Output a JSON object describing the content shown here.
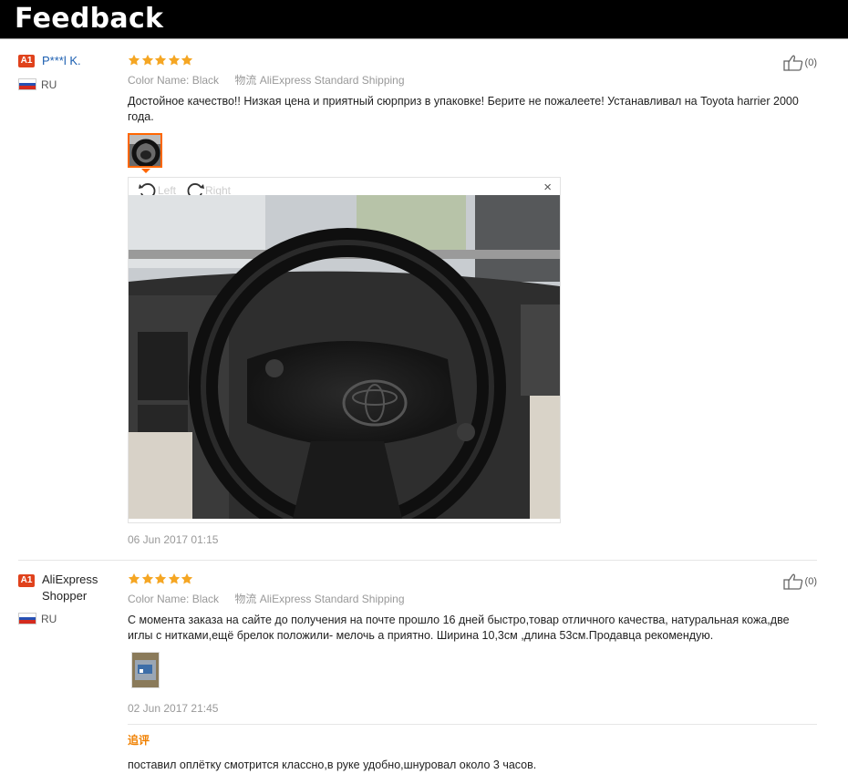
{
  "header": {
    "title": "Feedback"
  },
  "reviews": [
    {
      "badge": "A1",
      "user": "P***l K.",
      "country": "RU",
      "stars": 5,
      "color_label": "Color Name:",
      "color_value": "Black",
      "shipping_label": "物流",
      "shipping_value": "AliExpress Standard Shipping",
      "text": "Достойное качество!! Низкая цена и приятный сюрприз в упаковке! Берите не пожалеете! Устанавливал на Toyota harrier 2000 года.",
      "helpful_count": "(0)",
      "viewer": {
        "rotate_left": "Left",
        "rotate_right": "Right",
        "close": "×"
      },
      "date": "06 Jun 2017 01:15"
    },
    {
      "badge": "A1",
      "user": "AliExpress Shopper",
      "country": "RU",
      "stars": 5,
      "color_label": "Color Name:",
      "color_value": "Black",
      "shipping_label": "物流",
      "shipping_value": "AliExpress Standard Shipping",
      "text": "С момента заказа на сайте до получения на почте прошло 16 дней быстро,товар отличного качества, натуральная кожа,две иглы с нитками,ещё брелок положили- мелочь а приятно. Ширина 10,3см ,длина 53см.Продавца рекомендую.",
      "helpful_count": "(0)",
      "date": "02 Jun 2017 21:45",
      "append_label": "追评",
      "append_text": "поставил оплётку смотрится классно,в руке удобно,шнуровал около 3 часов."
    }
  ],
  "colors": {
    "star": "#f5a623",
    "badge": "#e0421c",
    "username_link": "#1c5fb1",
    "active_thumb": "#ff6600"
  }
}
